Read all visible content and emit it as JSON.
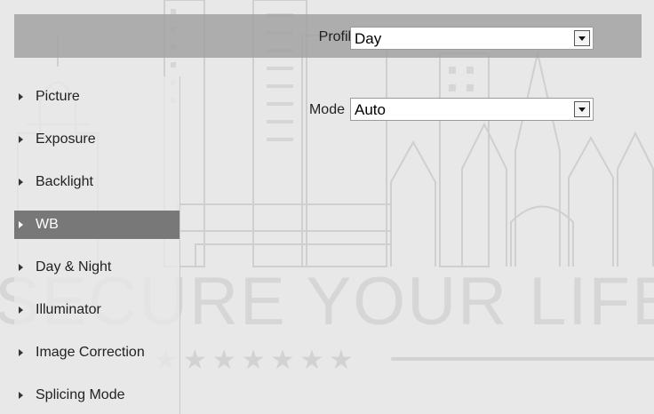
{
  "header": {
    "profile_label": "Profile",
    "profile_value": "Day"
  },
  "wb": {
    "mode_label": "Mode",
    "mode_value": "Auto"
  },
  "sidebar": {
    "items": [
      {
        "label": "Picture",
        "active": false
      },
      {
        "label": "Exposure",
        "active": false
      },
      {
        "label": "Backlight",
        "active": false
      },
      {
        "label": "WB",
        "active": true
      },
      {
        "label": "Day & Night",
        "active": false
      },
      {
        "label": "Illuminator",
        "active": false
      },
      {
        "label": "Image Correction",
        "active": false
      },
      {
        "label": "Splicing Mode",
        "active": false
      }
    ]
  },
  "watermark": {
    "text": "SECURE YOUR LIFE",
    "stars": "★★★★★★★"
  },
  "icons": {
    "sidebar_bullet": "triangle-right-icon",
    "dropdown": "chevron-down-icon"
  },
  "colors": {
    "header_bar": "#a0a0a0",
    "active_item": "#787878",
    "page_bg": "#e8e8e8"
  }
}
